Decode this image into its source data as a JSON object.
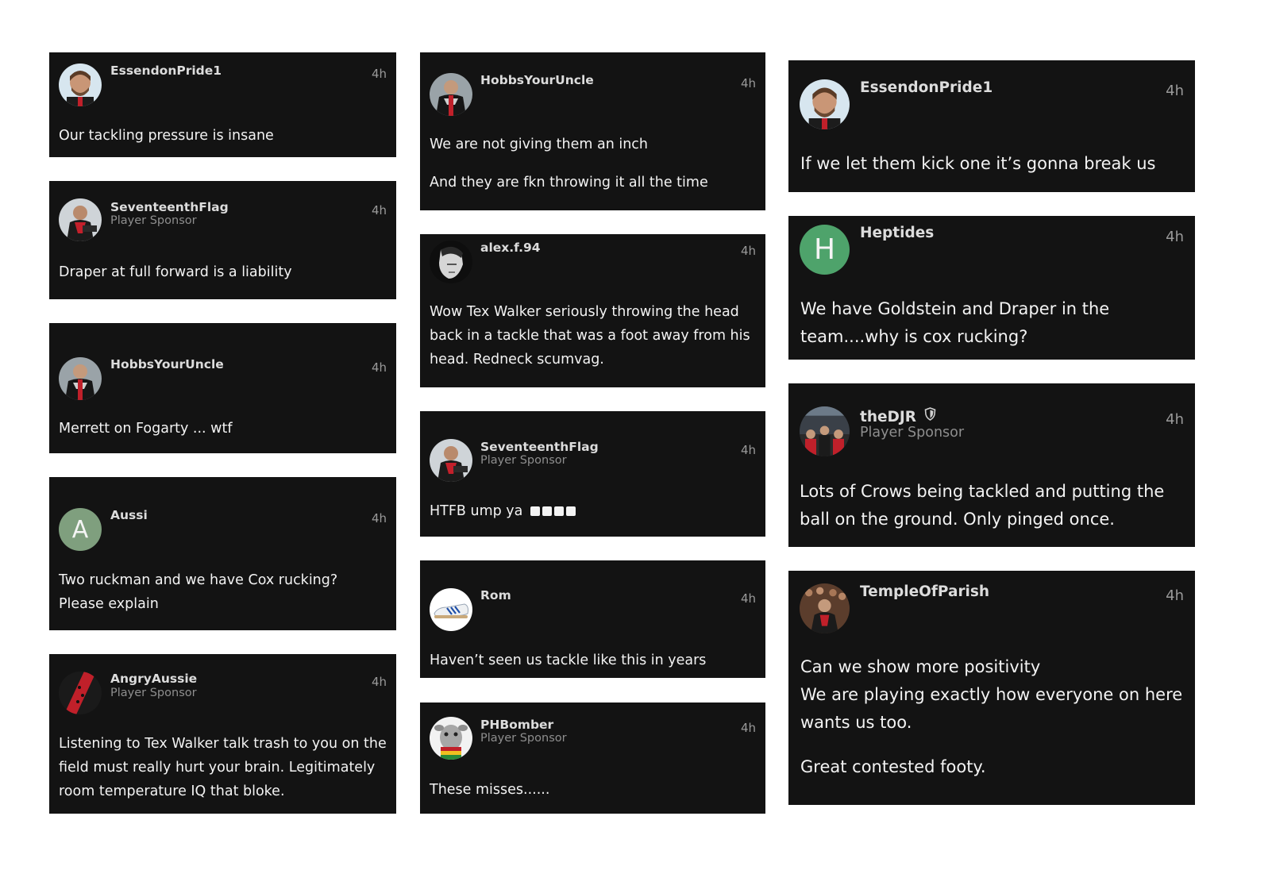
{
  "posts": [
    {
      "user": "EssendonPride1",
      "time": "4h",
      "text": "Our tackling pressure is insane"
    },
    {
      "user": "SeventeenthFlag",
      "sponsor": "Player Sponsor",
      "time": "4h",
      "text": "Draper at full forward is a liability"
    },
    {
      "user": "HobbsYourUncle",
      "time": "4h",
      "text": "Merrett on Fogarty ... wtf"
    },
    {
      "user": "Aussi",
      "avatar_letter": "A",
      "avatar_color": "#7f9f7e",
      "time": "4h",
      "text": "Two ruckman and we have Cox rucking? Please explain"
    },
    {
      "user": "AngryAussie",
      "sponsor": "Player Sponsor",
      "time": "4h",
      "text": "Listening to Tex Walker talk trash to you on the field must really hurt your brain. Legitimately room temperature IQ that bloke."
    },
    {
      "user": "HobbsYourUncle",
      "time": "4h",
      "text_lines": [
        "We are not giving them an inch",
        "And they are fkn throwing it all the time"
      ]
    },
    {
      "user": "alex.f.94",
      "time": "4h",
      "text": "Wow Tex Walker seriously throwing the head back in a tackle that was a foot away from his head. Redneck scumvag."
    },
    {
      "user": "SeventeenthFlag",
      "sponsor": "Player Sponsor",
      "time": "4h",
      "text": "HTFB ump ya"
    },
    {
      "user": "Rom",
      "time": "4h",
      "text": "Haven’t seen us tackle like this in years"
    },
    {
      "user": "PHBomber",
      "sponsor": "Player Sponsor",
      "time": "4h",
      "text": "These misses......"
    },
    {
      "user": "EssendonPride1",
      "time": "4h",
      "text": "If we let them kick one it’s gonna break us"
    },
    {
      "user": "Heptides",
      "avatar_letter": "H",
      "avatar_color": "#4ea36b",
      "time": "4h",
      "text": "We have Goldstein and Draper in the team....why is cox rucking?"
    },
    {
      "user": "theDJR",
      "sponsor": "Player Sponsor",
      "time": "4h",
      "text": "Lots of Crows being tackled and putting the ball on the ground. Only pinged once."
    },
    {
      "user": "TempleOfParish",
      "time": "4h",
      "text_lines": [
        "Can we show more positivity",
        "We are playing exactly how everyone on here wants us too.",
        "Great contested footy."
      ]
    }
  ],
  "colors": {
    "card": "#131313",
    "page": "#ffffff",
    "text": "#f3f3f3",
    "meta": "#9a9a9a"
  }
}
